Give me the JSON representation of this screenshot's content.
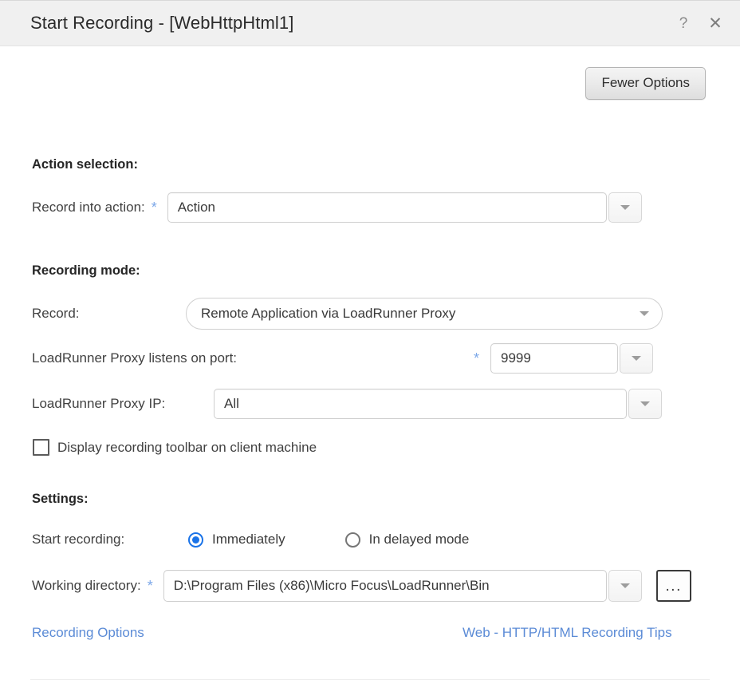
{
  "window": {
    "title": "Start Recording - [WebHttpHtml1]",
    "help_icon_label": "?",
    "close_icon_label": "✕"
  },
  "toolbar": {
    "fewer_options_label": "Fewer Options"
  },
  "sections": {
    "action_selection": {
      "heading": "Action selection:",
      "record_into_action": {
        "label": "Record into action:",
        "required_marker": "*",
        "value": "Action"
      }
    },
    "recording_mode": {
      "heading": "Recording mode:",
      "record": {
        "label": "Record:",
        "value": "Remote Application via LoadRunner Proxy"
      },
      "proxy_port": {
        "label": "LoadRunner Proxy listens on port:",
        "required_marker": "*",
        "value": "9999"
      },
      "proxy_ip": {
        "label": "LoadRunner Proxy IP:",
        "value": "All"
      },
      "display_toolbar": {
        "label": "Display recording toolbar on client machine",
        "checked": false
      }
    },
    "settings": {
      "heading": "Settings:",
      "start_recording": {
        "label": "Start recording:",
        "options": [
          {
            "label": "Immediately",
            "selected": true
          },
          {
            "label": "In delayed mode",
            "selected": false
          }
        ]
      },
      "working_directory": {
        "label": "Working directory:",
        "required_marker": "*",
        "value": "D:\\Program Files (x86)\\Micro Focus\\LoadRunner\\Bin",
        "browse_label": "..."
      }
    }
  },
  "links": {
    "recording_options": "Recording Options",
    "recording_tips": "Web - HTTP/HTML Recording Tips"
  },
  "colors": {
    "accent_blue": "#1a73e8",
    "link_blue": "#5b8bd6",
    "required_star": "#7ba7e8",
    "titlebar_bg": "#f0f0f0"
  }
}
